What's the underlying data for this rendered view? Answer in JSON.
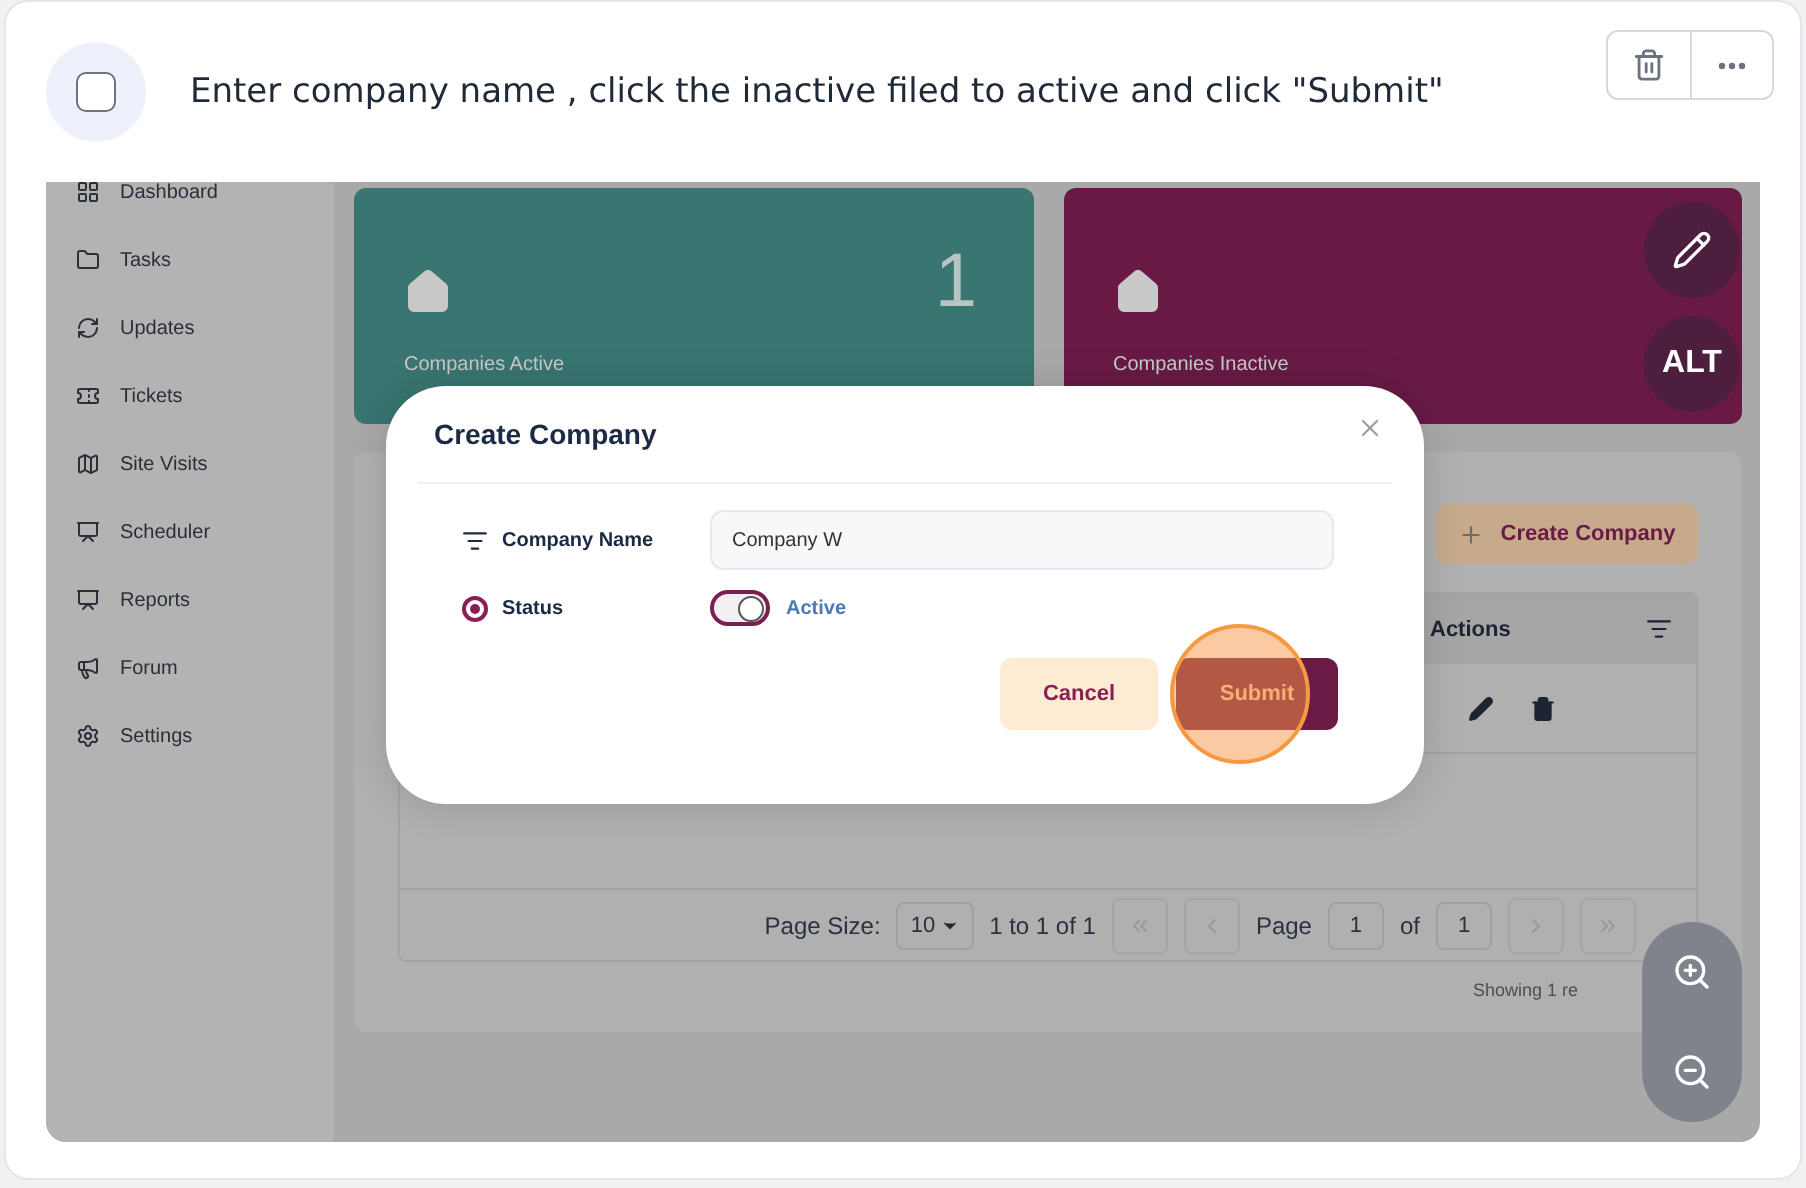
{
  "step": {
    "text": "Enter company name , click the inactive filed to active and click \"Submit\"",
    "checked": false
  },
  "sidebar": {
    "items": [
      {
        "label": "Dashboard"
      },
      {
        "label": "Tasks"
      },
      {
        "label": "Updates"
      },
      {
        "label": "Tickets"
      },
      {
        "label": "Site Visits"
      },
      {
        "label": "Scheduler"
      },
      {
        "label": "Reports"
      },
      {
        "label": "Forum"
      },
      {
        "label": "Settings"
      }
    ]
  },
  "stats": [
    {
      "label": "Companies Active",
      "value": "1",
      "color": "#397571"
    },
    {
      "label": "Companies Inactive",
      "color": "#681a45"
    }
  ],
  "create_button": "Create Company",
  "table": {
    "columns": [
      "Actions"
    ]
  },
  "pagination": {
    "page_size_label": "Page Size:",
    "page_size": "10",
    "range": "1 to 1 of 1",
    "page_label": "Page",
    "page": "1",
    "of_label": "of",
    "total": "1"
  },
  "footer_note": "Showing 1 re",
  "modal": {
    "title": "Create Company",
    "company_name_label": "Company Name",
    "company_name": "Company W",
    "status_label": "Status",
    "status_selected": true,
    "toggle_on": true,
    "toggle_label": "Active",
    "cancel": "Cancel",
    "submit": "Submit"
  },
  "alt_label": "ALT"
}
